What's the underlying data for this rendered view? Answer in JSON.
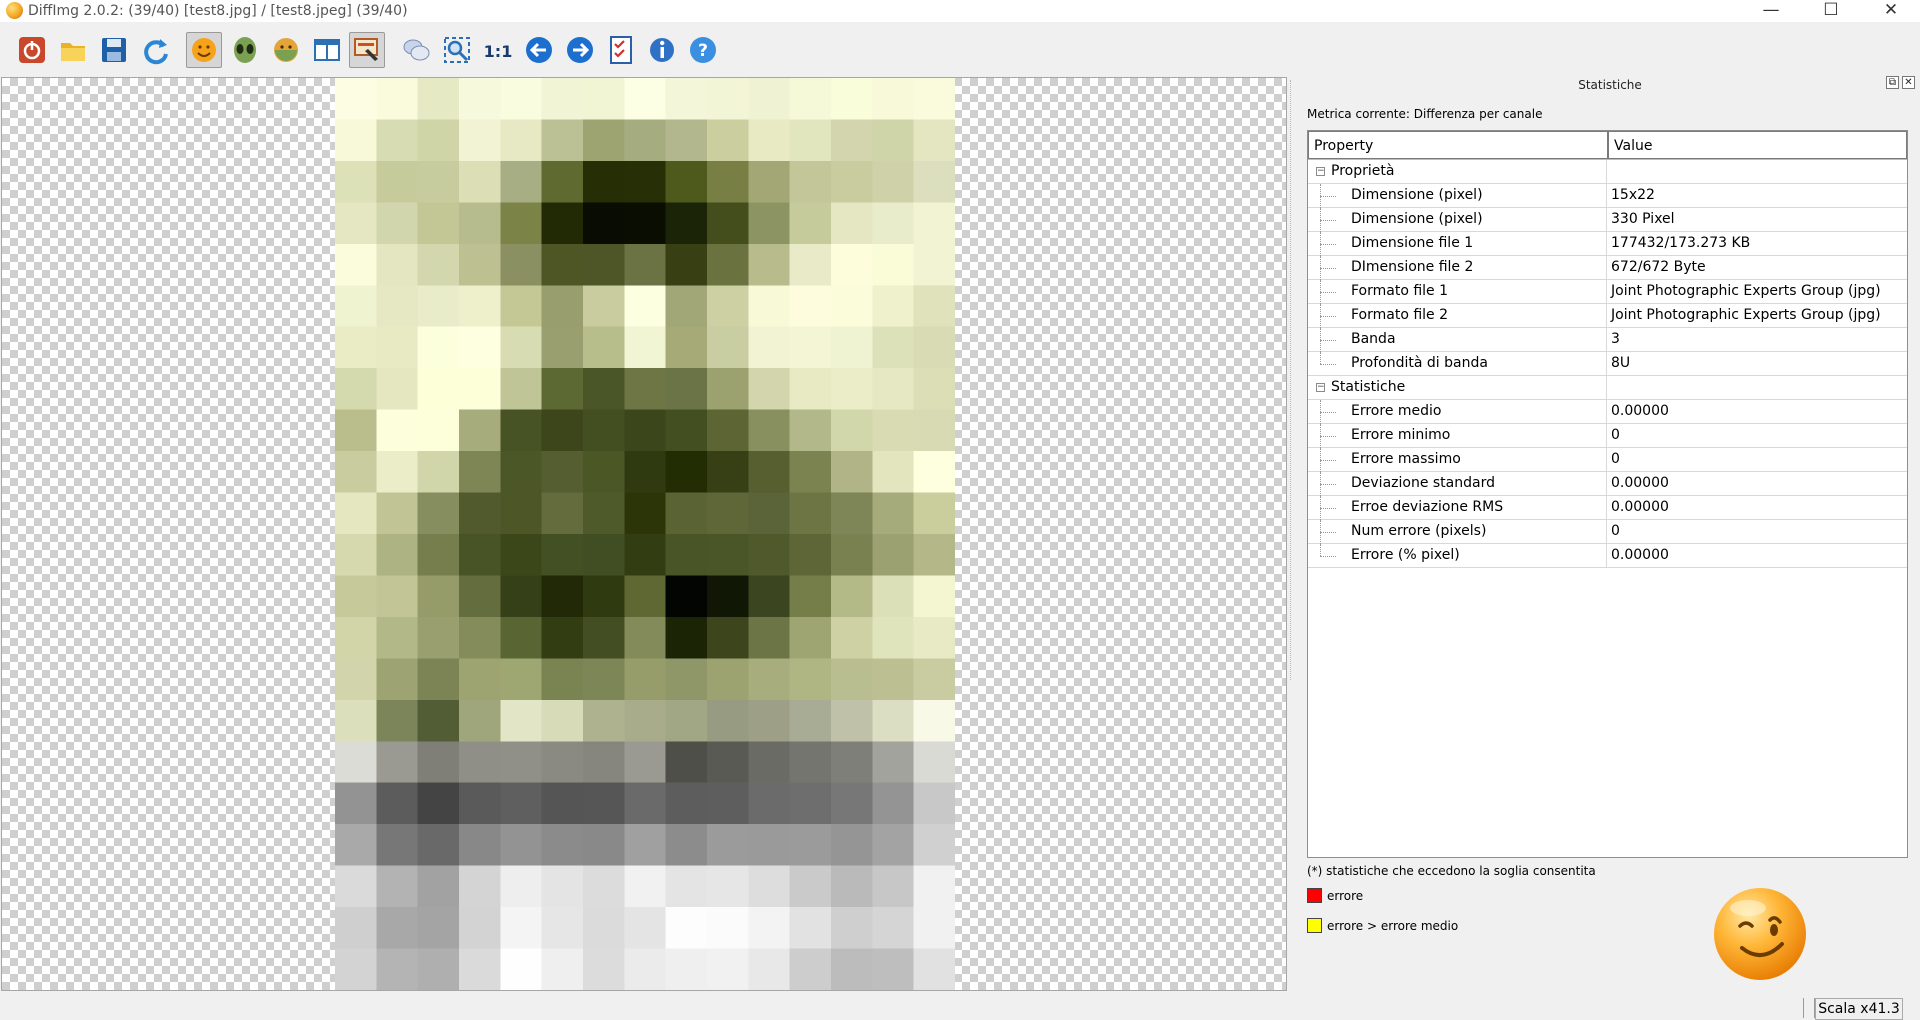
{
  "window": {
    "title": "DiffImg 2.0.2:  (39/40) [test8.jpg] / [test8.jpeg] (39/40)",
    "minimize": "—",
    "maximize": "☐",
    "close": "✕"
  },
  "toolbar": {
    "buttons": [
      {
        "icon": "power-icon",
        "pressed": false
      },
      {
        "icon": "open-folder-icon",
        "pressed": false
      },
      {
        "icon": "save-icon",
        "pressed": false
      },
      {
        "icon": "refresh-icon",
        "pressed": false
      },
      {
        "icon": "smiley-image1-icon",
        "pressed": true
      },
      {
        "icon": "alien-image2-icon",
        "pressed": false
      },
      {
        "icon": "difference-image-icon",
        "pressed": false
      },
      {
        "icon": "dual-panel-icon",
        "pressed": false
      },
      {
        "icon": "gradient-edit-icon",
        "pressed": true
      },
      {
        "icon": "chat-bubbles-icon",
        "pressed": false
      },
      {
        "icon": "zoom-fit-icon",
        "pressed": false
      },
      {
        "icon": "zoom-1to1-icon",
        "pressed": false
      },
      {
        "icon": "arrow-left-icon",
        "pressed": false
      },
      {
        "icon": "arrow-right-icon",
        "pressed": false
      },
      {
        "icon": "checklist-icon",
        "pressed": false
      },
      {
        "icon": "info-icon",
        "pressed": false
      },
      {
        "icon": "help-icon",
        "pressed": false
      }
    ],
    "zoom_1to1_label": "1:1"
  },
  "image": {
    "cols": 15,
    "rows": 22,
    "pixels": [
      [
        "#fdfde4",
        "#fafbdc",
        "#e5eac4",
        "#f7f9dc",
        "#fafcdf",
        "#f1f5d6",
        "#f2f5d4",
        "#fcffe3",
        "#f3f6d9",
        "#f3f6d6",
        "#f0f3d3",
        "#f6f9d8",
        "#fafdd9",
        "#f7f9d9",
        "#fafbdc"
      ],
      [
        "#f8f9d9",
        "#d8dcb2",
        "#d0d5a8",
        "#f1f3d4",
        "#e6e9c4",
        "#bbc095",
        "#9da472",
        "#a5ac80",
        "#b2b78d",
        "#cbce9f",
        "#e7eac2",
        "#e2e6be",
        "#d2d5ad",
        "#cfd5a8",
        "#e3e6c0"
      ],
      [
        "#dde1b8",
        "#c6cb9c",
        "#c7cc9e",
        "#dcdfb6",
        "#a8ae84",
        "#5f6a30",
        "#262e05",
        "#262f05",
        "#4d5a1c",
        "#777f44",
        "#a2a775",
        "#c2c699",
        "#c8cc9f",
        "#cfd2a8",
        "#dcdfbe"
      ],
      [
        "#e5e7c3",
        "#d2d6ac",
        "#c3c796",
        "#b7bc8f",
        "#7b8346",
        "#212905",
        "#080c02",
        "#0a0e02",
        "#1c2407",
        "#444e1c",
        "#8d9463",
        "#c6cb9c",
        "#e4e7c2",
        "#e9ecca",
        "#f1f3d2"
      ],
      [
        "#fafcdb",
        "#e3e6c0",
        "#d3d7ad",
        "#bdc192",
        "#8a9061",
        "#4e5626",
        "#4e5526",
        "#6b7244",
        "#383f12",
        "#6a7240",
        "#b8bc8c",
        "#e9ebc8",
        "#fdfddb",
        "#fafcd8",
        "#f1f3d3"
      ],
      [
        "#f0f3d0",
        "#e5e8c2",
        "#e9ecc8",
        "#eef0cc",
        "#c4c895",
        "#999e6e",
        "#c9cc9e",
        "#fcffe0",
        "#a1a776",
        "#cdd0a3",
        "#f7f9d7",
        "#fdfddd",
        "#fbfdda",
        "#eef1cc",
        "#dfe2bb"
      ],
      [
        "#e9ecc5",
        "#e7eac3",
        "#fcffdc",
        "#fdffe0",
        "#d8dcb2",
        "#999f6e",
        "#b8bd8c",
        "#f2f5d4",
        "#a5aa77",
        "#c9cda2",
        "#f1f3d2",
        "#f3f5d4",
        "#f0f3d1",
        "#dde1ba",
        "#d8dbb3"
      ],
      [
        "#d5d9ae",
        "#e4e7c0",
        "#fdffd8",
        "#fdffd9",
        "#c0c598",
        "#5d6933",
        "#4a5528",
        "#6d7644",
        "#6b7447",
        "#9ba270",
        "#d3d6ac",
        "#e7eac2",
        "#eaedc8",
        "#e6e8c4",
        "#dcdfb6"
      ],
      [
        "#b9be8c",
        "#fdffdc",
        "#fdffdb",
        "#a7ac7d",
        "#485325",
        "#3c461a",
        "#444f21",
        "#3b461a",
        "#444f21",
        "#5c6533",
        "#89905f",
        "#b3b88a",
        "#d2d6ab",
        "#d9dcb2",
        "#d7dab2"
      ],
      [
        "#c8cc9e",
        "#eaedc8",
        "#d1d5aa",
        "#7e8656",
        "#4c5727",
        "#545e30",
        "#4c5726",
        "#2f3a10",
        "#232d04",
        "#373f15",
        "#575f30",
        "#7b8351",
        "#b0b487",
        "#e2e5bd",
        "#fdffde"
      ],
      [
        "#e4e7bf",
        "#c1c595",
        "#868d5e",
        "#505a2c",
        "#4c5627",
        "#646c3d",
        "#4f5a2a",
        "#2c3508",
        "#5a6333",
        "#5f6638",
        "#5b6338",
        "#6d7545",
        "#7e8556",
        "#a5ab7b",
        "#cacd9c"
      ],
      [
        "#d6d9ae",
        "#aeb383",
        "#767e4e",
        "#485326",
        "#3c4719",
        "#435024",
        "#414d22",
        "#323e12",
        "#4a5527",
        "#4b5628",
        "#4f592c",
        "#5e6637",
        "#798151",
        "#9ba170",
        "#b4b888"
      ],
      [
        "#c6ca9b",
        "#c2c697",
        "#959c69",
        "#646d3d",
        "#364018",
        "#212906",
        "#303a10",
        "#5f6832",
        "#020501",
        "#101805",
        "#3b4520",
        "#757d48",
        "#b4b988",
        "#dce0b9",
        "#f4f6d2"
      ],
      [
        "#d1d5a8",
        "#b3b889",
        "#999f6e",
        "#858c5b",
        "#5a6534",
        "#323e12",
        "#434f22",
        "#838b5a",
        "#1b2404",
        "#3c451c",
        "#6c7546",
        "#9ea572",
        "#cdd1a4",
        "#e0e4bc",
        "#e7eac5"
      ],
      [
        "#d2d5ab",
        "#9da373",
        "#7c8455",
        "#9ea471",
        "#9ea671",
        "#7a8352",
        "#7d8656",
        "#969d6b",
        "#8f9667",
        "#9ca370",
        "#a7ad7c",
        "#b0b584",
        "#b9be90",
        "#bbbf92",
        "#c8cca0"
      ],
      [
        "#dcdfbb",
        "#7c845a",
        "#535d35",
        "#a0a67c",
        "#e2e6c6",
        "#d7dbb8",
        "#aeb28e",
        "#a8ac8a",
        "#a1a684",
        "#979b82",
        "#9d9f87",
        "#a9ac95",
        "#bfc2a9",
        "#dcdec4",
        "#f8f9e6"
      ],
      [
        "#dcdcd6",
        "#9a9a92",
        "#7f7f78",
        "#8f8f88",
        "#909089",
        "#8a8a83",
        "#86867f",
        "#9a9a93",
        "#4f4f4a",
        "#5a5a54",
        "#6b6b65",
        "#75756f",
        "#7f7f79",
        "#a3a39d",
        "#dadad4"
      ],
      [
        "#939393",
        "#5c5c5c",
        "#444444",
        "#5a5a5a",
        "#5f5f5f",
        "#555555",
        "#565656",
        "#6a6a6a",
        "#5d5d5d",
        "#5e5e5e",
        "#6b6b6b",
        "#6e6e6e",
        "#777777",
        "#949494",
        "#c8c8c8"
      ],
      [
        "#a9a9a9",
        "#777777",
        "#696969",
        "#888888",
        "#939393",
        "#8b8b8b",
        "#898989",
        "#a0a0a0",
        "#8c8c8c",
        "#9b9b9b",
        "#9a9a9a",
        "#9b9b9b",
        "#959595",
        "#a3a3a3",
        "#d0d0d0"
      ],
      [
        "#dadada",
        "#b3b3b3",
        "#a2a2a2",
        "#d4d4d4",
        "#eeeeee",
        "#e4e4e4",
        "#dcdcdc",
        "#f1f1f1",
        "#e4e4e4",
        "#e6e6e6",
        "#dddddd",
        "#cacaca",
        "#bababa",
        "#c7c7c7",
        "#f1f1f1"
      ],
      [
        "#cfcfcf",
        "#a8a8a8",
        "#a4a4a4",
        "#d3d3d3",
        "#f4f4f4",
        "#e6e6e6",
        "#dbdbdb",
        "#e4e4e4",
        "#fdfdfd",
        "#fbfbfb",
        "#f3f3f3",
        "#e2e2e2",
        "#cfcfcf",
        "#d5d5d5",
        "#f1f1f1"
      ],
      [
        "#d3d3d3",
        "#b4b4b4",
        "#afafaf",
        "#dadada",
        "#fefefe",
        "#efefef",
        "#dcdcdc",
        "#ebebeb",
        "#efefef",
        "#f1f1f1",
        "#e8e8e8",
        "#cdcdcd",
        "#bcbcbc",
        "#bebebe",
        "#e1e1e1"
      ]
    ]
  },
  "panel": {
    "title": "Statistiche",
    "float_btn": "⧉",
    "close_btn": "✕",
    "metric": "Metrica corrente: Differenza per canale",
    "header_property": "Property",
    "header_value": "Value",
    "groups": [
      {
        "label": "Proprietà",
        "rows": [
          {
            "prop": "Dimensione (pixel)",
            "val": "15x22"
          },
          {
            "prop": "Dimensione (pixel)",
            "val": "330 Pixel"
          },
          {
            "prop": "Dimensione file 1",
            "val": "177432/173.273 KB"
          },
          {
            "prop": "DImensione file 2",
            "val": "672/672 Byte"
          },
          {
            "prop": "Formato file 1",
            "val": "Joint Photographic Experts Group (jpg)"
          },
          {
            "prop": "Formato file 2",
            "val": "Joint Photographic Experts Group (jpg)"
          },
          {
            "prop": "Banda",
            "val": "3"
          },
          {
            "prop": "Profondità di banda",
            "val": "8U"
          }
        ]
      },
      {
        "label": "Statistiche",
        "rows": [
          {
            "prop": "Errore medio",
            "val": "0.00000"
          },
          {
            "prop": "Errore minimo",
            "val": "0"
          },
          {
            "prop": "Errore massimo",
            "val": "0"
          },
          {
            "prop": "Deviazione standard",
            "val": "0.00000"
          },
          {
            "prop": "Erroe deviazione RMS",
            "val": "0.00000"
          },
          {
            "prop": "Num errore (pixels)",
            "val": "0"
          },
          {
            "prop": "Errore (% pixel)",
            "val": "0.00000"
          }
        ]
      }
    ],
    "footnote": "(*) statistiche che eccedono la soglia consentita",
    "legend": [
      {
        "label": "errore",
        "color": "#ff0000"
      },
      {
        "label": "errore > errore medio",
        "color": "#ffff00"
      }
    ]
  },
  "status": {
    "scale": "Scala x41.3"
  }
}
